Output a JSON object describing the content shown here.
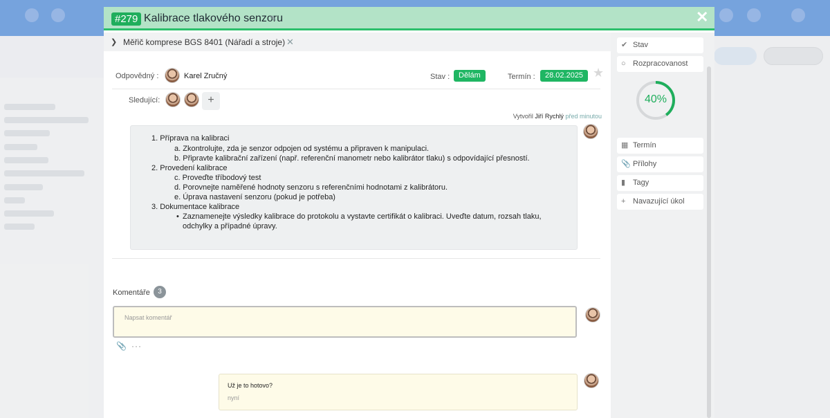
{
  "header": {
    "task_id": "#279",
    "title": "Kalibrace tlakového senzoru",
    "close_label": "✕"
  },
  "breadcrumb": {
    "text": "Měřič komprese BGS 8401 (Nářadí a stroje)"
  },
  "meta": {
    "responsible_label": "Odpovědný :",
    "responsible_name": "Karel Zručný",
    "status_label": "Stav :",
    "status_value": "Dělám",
    "deadline_label": "Termín :",
    "deadline_value": "28.02.2025",
    "followers_label": "Sledující:",
    "add_follower": "+"
  },
  "creator": {
    "prefix": "Vytvořil",
    "name": "Jiří Rychlý",
    "when": "před minutou"
  },
  "description": [
    "1. Příprava na kalibraci",
    "a. Zkontrolujte, zda je senzor odpojen od systému a připraven k manipulaci.",
    "b. Připravte kalibrační zařízení (např. referenční manometr nebo kalibrátor tlaku) s odpovídající přesností.",
    "2. Provedení kalibrace",
    "c. Proveďte tříbodový test",
    "d. Porovnejte naměřené hodnoty senzoru s referenčními hodnotami z kalibrátoru.",
    "e. Úprava nastavení senzoru (pokud je potřeba)",
    "3. Dokumentace kalibrace",
    "Zaznamenejte výsledky kalibrace do protokolu a vystavte certifikát o kalibraci. Uveďte datum, rozsah tlaku,",
    "odchylky a případné úpravy."
  ],
  "comments": {
    "title": "Komentáře",
    "count": "3",
    "input_placeholder": "Napsat komentář",
    "items": [
      {
        "text": "Už je to hotovo?",
        "time": "nyní"
      }
    ]
  },
  "side": {
    "status": "Stav",
    "progress_btn": "Rozpracovanost",
    "progress_value": 40,
    "progress_label": "40%",
    "deadline": "Termín",
    "attachments": "Přílohy",
    "tags": "Tagy",
    "follow_up": "Navazující úkol"
  },
  "colors": {
    "accent_green": "#1fae5c",
    "header_bg": "#b3e3c7"
  }
}
